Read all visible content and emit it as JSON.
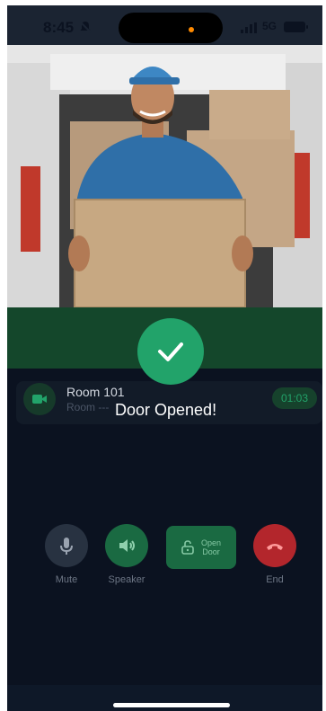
{
  "status_bar": {
    "time": "8:45",
    "network": "5G"
  },
  "call": {
    "room_title": "Room 101",
    "room_subtitle": "Room ---",
    "timer": "01:03"
  },
  "overlay": {
    "message": "Door Opened!"
  },
  "controls": {
    "mute_label": "Mute",
    "speaker_label": "Speaker",
    "open_door_line1": "Open",
    "open_door_line2": "Door",
    "end_label": "End"
  },
  "colors": {
    "background": "#0b1220",
    "accent_green": "#22a36a",
    "end_red": "#b3262c"
  },
  "icons": {
    "mute": "mic-icon",
    "speaker": "speaker-icon",
    "open_door": "lock-icon",
    "end": "phone-hangup-icon",
    "success": "checkmark-icon",
    "room": "video-camera-icon"
  }
}
